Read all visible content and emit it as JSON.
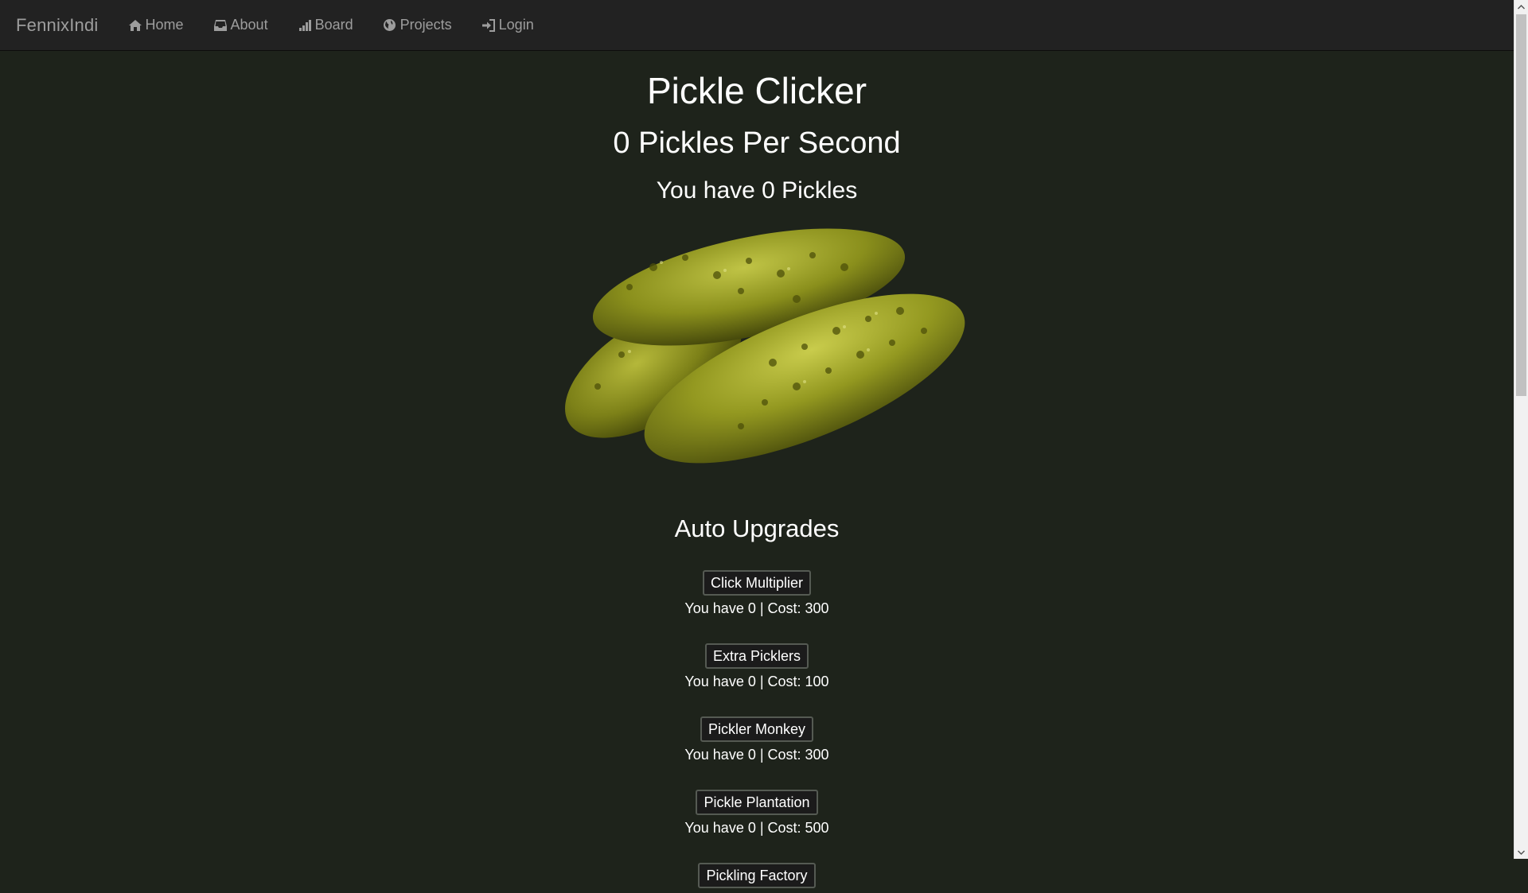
{
  "navbar": {
    "brand": "FennixIndi",
    "items": [
      {
        "label": "Home",
        "icon": "home-icon"
      },
      {
        "label": "About",
        "icon": "inbox-icon"
      },
      {
        "label": "Board",
        "icon": "signal-icon"
      },
      {
        "label": "Projects",
        "icon": "globe-icon"
      },
      {
        "label": "Login",
        "icon": "login-icon"
      }
    ]
  },
  "main": {
    "title": "Pickle Clicker",
    "pps": "0 Pickles Per Second",
    "count": "You have 0 Pickles",
    "upgrades_title": "Auto Upgrades",
    "upgrades": [
      {
        "label": "Click Multiplier",
        "info": "You have 0 | Cost: 300"
      },
      {
        "label": "Extra Picklers",
        "info": "You have 0 | Cost: 100"
      },
      {
        "label": "Pickler Monkey",
        "info": "You have 0 | Cost: 300"
      },
      {
        "label": "Pickle Plantation",
        "info": "You have 0 | Cost: 500"
      },
      {
        "label": "Pickling Factory",
        "info": ""
      }
    ]
  },
  "colors": {
    "background": "#1e231b",
    "navbar": "#222222",
    "nav_text": "#9d9d9d",
    "pickle": "#8a8f1c"
  }
}
